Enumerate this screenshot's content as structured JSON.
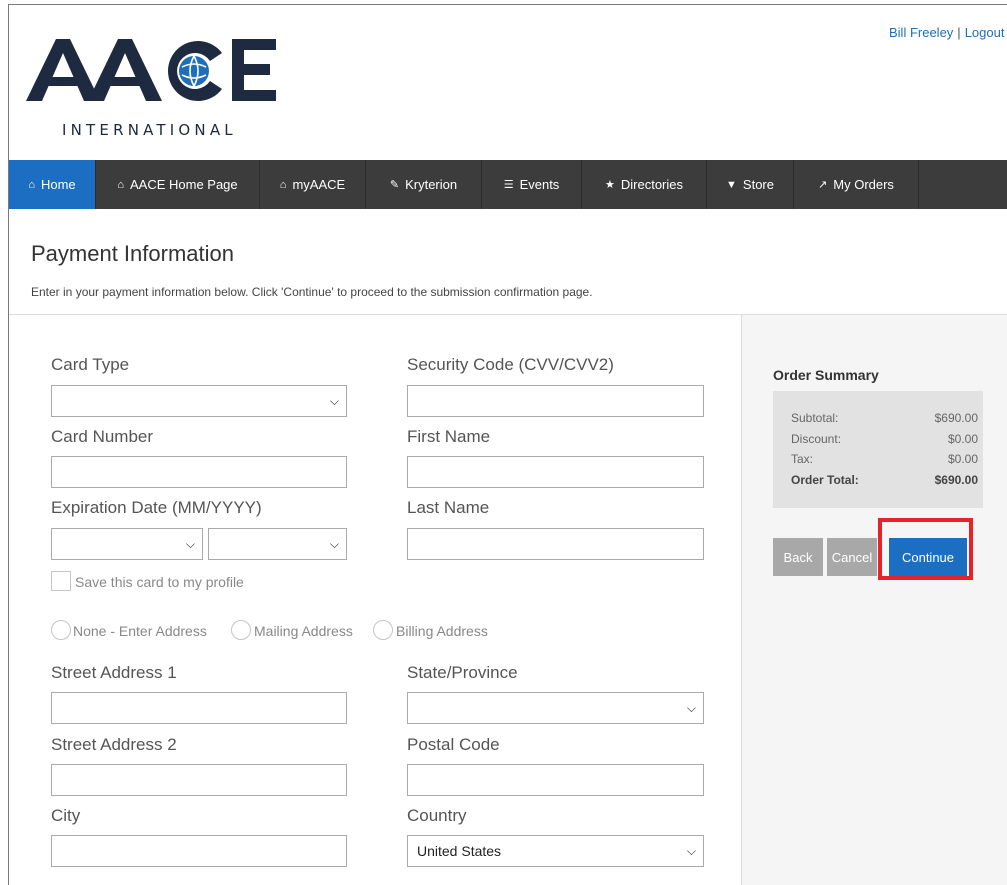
{
  "header": {
    "logo_text": "AACE",
    "logo_subtitle": "INTERNATIONAL",
    "user_name": "Bill Freeley",
    "separator": "|",
    "logout_label": "Logout"
  },
  "nav": [
    {
      "label": "Home",
      "icon": "home-icon",
      "glyph": "⌂",
      "active": true
    },
    {
      "label": "AACE Home Page",
      "icon": "home-icon",
      "glyph": "⌂"
    },
    {
      "label": "myAACE",
      "icon": "home-icon",
      "glyph": "⌂"
    },
    {
      "label": "Kryterion",
      "icon": "edit-icon",
      "glyph": "✎"
    },
    {
      "label": "Events",
      "icon": "list-icon",
      "glyph": "☰"
    },
    {
      "label": "Directories",
      "icon": "star-icon",
      "glyph": "★"
    },
    {
      "label": "Store",
      "icon": "cart-icon",
      "glyph": "▼"
    },
    {
      "label": "My Orders",
      "icon": "pin-icon",
      "glyph": "↗"
    }
  ],
  "page": {
    "title": "Payment Information",
    "subtitle": "Enter in your payment information below. Click 'Continue' to proceed to the submission confirmation page."
  },
  "form": {
    "card_type_label": "Card Type",
    "card_type_value": "",
    "card_number_label": "Card Number",
    "expiration_label": "Expiration Date (MM/YYYY)",
    "expiration_month_value": "",
    "expiration_year_value": "",
    "security_code_label": "Security Code (CVV/CVV2)",
    "first_name_label": "First Name",
    "last_name_label": "Last Name",
    "save_card_label": "Save this card to my profile",
    "address_options": [
      "None - Enter Address",
      "Mailing Address",
      "Billing Address"
    ],
    "street1_label": "Street Address 1",
    "street2_label": "Street Address 2",
    "city_label": "City",
    "state_label": "State/Province",
    "state_value": "",
    "postal_label": "Postal Code",
    "country_label": "Country",
    "country_value": "United States"
  },
  "order_summary": {
    "title": "Order Summary",
    "rows": [
      {
        "label": "Subtotal:",
        "value": "$690.00"
      },
      {
        "label": "Discount:",
        "value": "$0.00"
      },
      {
        "label": "Tax:",
        "value": "$0.00"
      },
      {
        "label": "Order Total:",
        "value": "$690.00",
        "bold": true
      }
    ]
  },
  "buttons": {
    "back": "Back",
    "cancel": "Cancel",
    "continue": "Continue"
  },
  "colors": {
    "nav_bg": "#3c3c3c",
    "nav_active": "#1b6ec2",
    "primary": "#1b6ec2",
    "highlight": "#e8222a",
    "logo_navy": "#1e2a3f",
    "logo_blue": "#1f6fb8"
  }
}
